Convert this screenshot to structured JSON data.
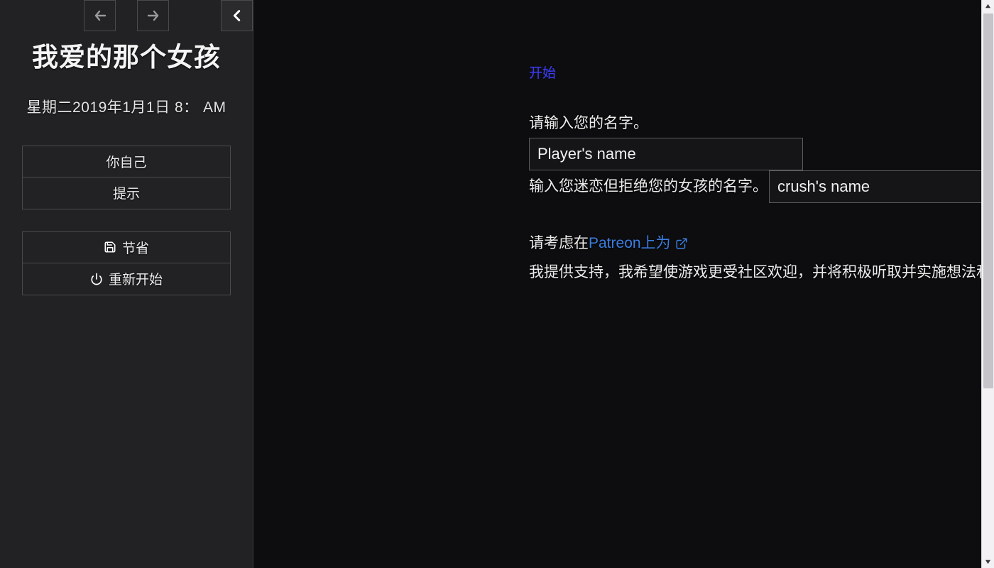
{
  "sidebar": {
    "nav": {
      "back_label": "Back",
      "forward_label": "Forward",
      "collapse_label": "Collapse sidebar",
      "back_icon": "arrow-left-icon",
      "forward_icon": "arrow-right-icon",
      "collapse_icon": "chevron-left-icon"
    },
    "title": "我爱的那个女孩",
    "date": "星期二2019年1月1日 8： AM",
    "menu_groups": [
      {
        "items": [
          {
            "label": "你自己",
            "icon": null
          },
          {
            "label": "提示",
            "icon": null
          }
        ]
      },
      {
        "items": [
          {
            "label": "节省",
            "icon": "save-icon"
          },
          {
            "label": "重新开始",
            "icon": "power-icon"
          }
        ]
      }
    ]
  },
  "main": {
    "passage_link": "开始",
    "name_prompt": "请输入您的名字。",
    "name_placeholder": "Player's name",
    "crush_prompt": "输入您迷恋但拒绝您的女孩的名字。",
    "crush_placeholder": "crush's name",
    "patreon": {
      "before": "请考虑在",
      "link_text": "Patreon上为",
      "link_icon": "external-link-icon",
      "after": "我提供支持，我希望使游戏更受社区欢迎，并将积极听取并实施想法和建议。"
    }
  },
  "scrollbar": {
    "up_icon": "scroll-up-arrow-icon",
    "down_icon": "scroll-down-arrow-icon",
    "thumb": "scrollbar-thumb"
  },
  "colors": {
    "sidebar_bg": "#222225",
    "content_bg": "#0d0d0f",
    "link_blue": "#3b3bee",
    "patreon_blue": "#3b7de0",
    "text": "#ececec"
  }
}
